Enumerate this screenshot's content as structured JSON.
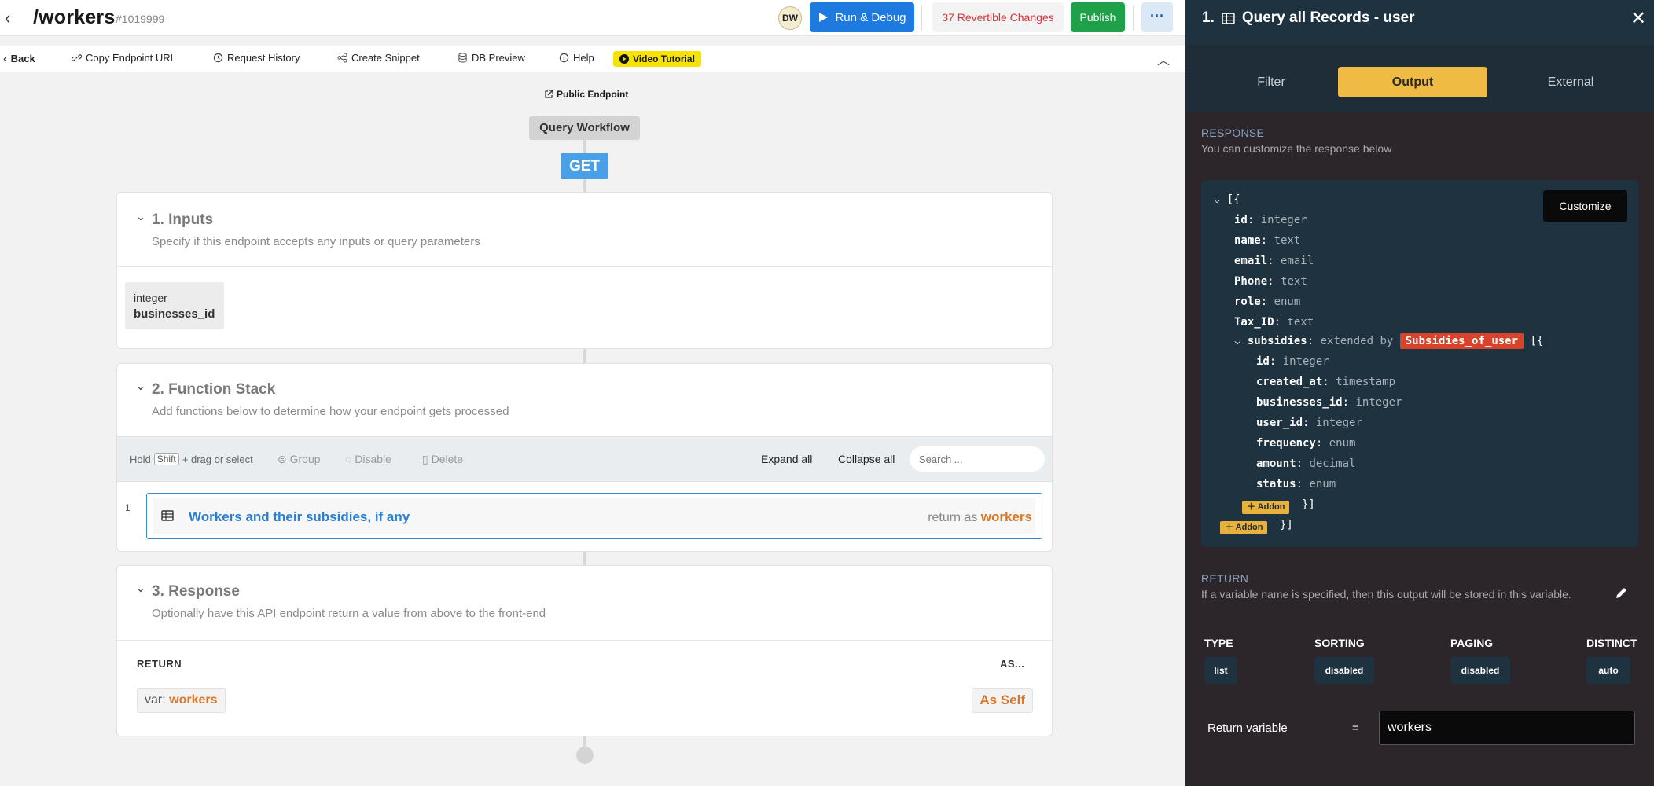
{
  "header": {
    "title": "/workers",
    "id": "#1019999",
    "avatar": "DW",
    "run_label": "Run & Debug",
    "changes_label": "37 Revertible Changes",
    "publish_label": "Publish",
    "more_label": "···"
  },
  "toolbar": {
    "back": "Back",
    "copy_url": "Copy Endpoint URL",
    "history": "Request History",
    "snippet": "Create Snippet",
    "db_preview": "DB Preview",
    "help": "Help",
    "video": "Video Tutorial"
  },
  "canvas": {
    "public_endpoint": "Public Endpoint",
    "workflow": "Query Workflow",
    "method": "GET",
    "inputs": {
      "title": "1. Inputs",
      "subtitle": "Specify if this endpoint accepts any inputs or query parameters",
      "items": [
        {
          "type": "integer",
          "name": "businesses_id"
        }
      ]
    },
    "function_stack": {
      "title": "2. Function Stack",
      "subtitle": "Add functions below to determine how your endpoint gets processed",
      "hold": "Hold",
      "shift": "Shift",
      "drag": "+ drag or select",
      "group": "Group",
      "disable": "Disable",
      "delete": "Delete",
      "expand_all": "Expand all",
      "collapse_all": "Collapse all",
      "search_placeholder": "Search ...",
      "functions": [
        {
          "num": "1",
          "title": "Workers and their subsidies, if any",
          "return_as_label": "return as",
          "return_var": "workers"
        }
      ]
    },
    "response": {
      "title": "3. Response",
      "subtitle": "Optionally have this API endpoint return a value from above to the front-end",
      "return_label": "RETURN",
      "as_label": "AS...",
      "var_prefix": "var:",
      "var_name": "workers",
      "as_self": "As Self"
    }
  },
  "panel": {
    "title": "1.",
    "title_text": "Query all Records - user",
    "tabs": [
      "Filter",
      "Output",
      "External"
    ],
    "active_tab": "Output",
    "response_head": "RESPONSE",
    "response_sub": "You can customize the response below",
    "customize": "Customize",
    "schema": {
      "open": "[{",
      "fields": [
        {
          "k": "id",
          "t": "integer"
        },
        {
          "k": "name",
          "t": "text"
        },
        {
          "k": "email",
          "t": "email"
        },
        {
          "k": "Phone",
          "t": "text"
        },
        {
          "k": "role",
          "t": "enum"
        },
        {
          "k": "Tax_ID",
          "t": "text"
        }
      ],
      "nested_key": "subsidies",
      "nested_ext": "extended by",
      "nested_table": "Subsidies_of_user",
      "nested_open": "[{",
      "nested_fields": [
        {
          "k": "id",
          "t": "integer"
        },
        {
          "k": "created_at",
          "t": "timestamp"
        },
        {
          "k": "businesses_id",
          "t": "integer"
        },
        {
          "k": "user_id",
          "t": "integer"
        },
        {
          "k": "frequency",
          "t": "enum"
        },
        {
          "k": "amount",
          "t": "decimal"
        },
        {
          "k": "status",
          "t": "enum"
        }
      ],
      "addon": "Addon",
      "close": "}]"
    },
    "return_head": "RETURN",
    "return_sub": "If a variable name is specified, then this output will be stored in this variable.",
    "stats": [
      {
        "label": "TYPE",
        "value": "list"
      },
      {
        "label": "SORTING",
        "value": "disabled"
      },
      {
        "label": "PAGING",
        "value": "disabled"
      },
      {
        "label": "DISTINCT",
        "value": "auto"
      }
    ],
    "return_variable_label": "Return variable",
    "eq": "=",
    "return_variable": "workers"
  },
  "colors": {
    "accent": "#1f7ae0",
    "publish": "#21a04a",
    "output_tab": "#f0bb45",
    "orange": "#d9772b",
    "panel_bg": "#2c2529"
  }
}
